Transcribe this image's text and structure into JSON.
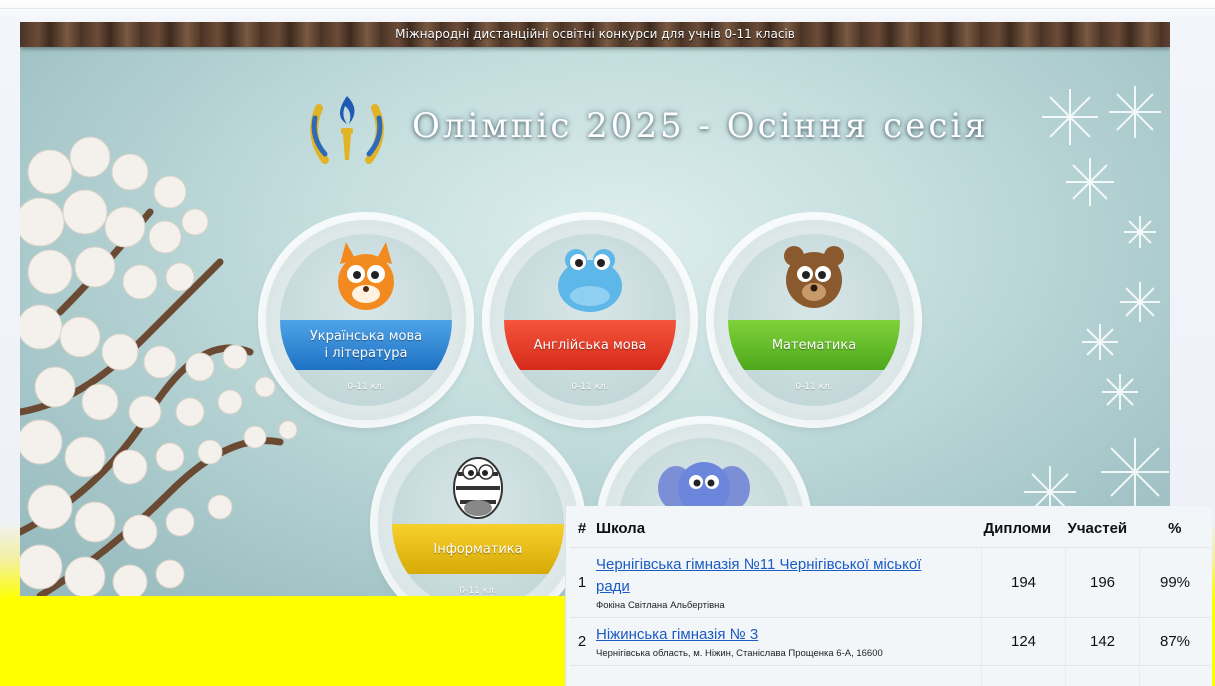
{
  "banner": {
    "top_text": "Міжнародні дистанційні освітні конкурси для учнів 0-11 класів",
    "title": "Олімпіс 2025 - Осіння сесія"
  },
  "subjects": [
    {
      "name": "Українська мова і література",
      "line1": "Українська мова",
      "line2": "і література",
      "grades": "0-11 кл.",
      "color": "#2f86d6",
      "mascot": "fox"
    },
    {
      "name": "Англійська мова",
      "line1": "Англійська мова",
      "line2": "",
      "grades": "0-11 кл.",
      "color": "#e43a25",
      "mascot": "hippo"
    },
    {
      "name": "Математика",
      "line1": "Математика",
      "line2": "",
      "grades": "0-11 кл.",
      "color": "#63bd2a",
      "mascot": "bear"
    },
    {
      "name": "Інформатика",
      "line1": "Інформатика",
      "line2": "",
      "grades": "0-11 кл.",
      "color": "#e8bd14",
      "mascot": "zebra"
    },
    {
      "name": "",
      "line1": "",
      "line2": "",
      "grades": "",
      "color": "#9560c6",
      "mascot": "elephant"
    }
  ],
  "ranking": {
    "headers": {
      "num": "#",
      "school": "Школа",
      "diplomas": "Дипломи",
      "participants": "Участей",
      "percent": "%"
    },
    "rows": [
      {
        "num": "1",
        "school": "Чернігівська гімназія №11 Чернігівської міської ради",
        "school_line1": "Чернігівська гімназія №11 Чернігівської міської",
        "school_line2": "ради",
        "sub": "Фокіна Світлана Альбертівна",
        "diplomas": "194",
        "participants": "196",
        "percent": "99%"
      },
      {
        "num": "2",
        "school": "Ніжинська гімназія № 3",
        "school_line1": "Ніжинська гімназія № 3",
        "school_line2": "",
        "sub": "Чернігівська область, м. Ніжин, Станіслава Прощенка 6-А, 16600",
        "diplomas": "124",
        "participants": "142",
        "percent": "87%"
      }
    ]
  },
  "colors": {
    "highlight_yellow": "#ffff00",
    "link_blue": "#1a5bc4",
    "wood_brown": "#5a3e2c"
  },
  "icons": [
    "olympic-torch-logo-icon",
    "snowflake-icon",
    "snowy-tree-illustration"
  ]
}
